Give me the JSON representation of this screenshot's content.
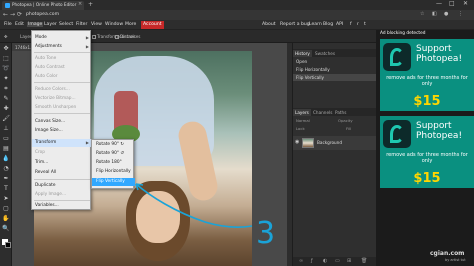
{
  "browser": {
    "tab_title": "Photopea | Online Photo Editor",
    "tab_close": "×",
    "new_tab": "+",
    "url": "photopea.com",
    "back": "←",
    "forward": "→",
    "reload": "⟳",
    "win_min": "—",
    "win_max": "□",
    "win_close": "✕"
  },
  "menubar": {
    "items": [
      "File",
      "Edit",
      "Image",
      "Layer",
      "Select",
      "Filter",
      "View",
      "Window",
      "More",
      "Account"
    ],
    "right": [
      "About",
      "Report a bug",
      "Learn",
      "Blog",
      "API"
    ],
    "social": [
      "f",
      "r",
      "t"
    ]
  },
  "options": {
    "autoselect": "Layer",
    "transform_controls": "Transform controls",
    "distances": "Distances"
  },
  "document": {
    "tab": "1746x1..."
  },
  "image_menu": {
    "items": [
      {
        "label": "Mode",
        "enabled": true,
        "submenu": true
      },
      {
        "label": "Adjustments",
        "enabled": true,
        "submenu": true
      },
      {
        "label": "Auto Tone",
        "enabled": false
      },
      {
        "label": "Auto Contrast",
        "enabled": false
      },
      {
        "label": "Auto Color",
        "enabled": false
      },
      {
        "label": "Reduce Colors...",
        "enabled": false
      },
      {
        "label": "Vectorize Bitmap...",
        "enabled": false
      },
      {
        "label": "Smooth Unsharpen",
        "enabled": false
      },
      {
        "label": "Canvas Size...",
        "enabled": true
      },
      {
        "label": "Image Size...",
        "enabled": true
      },
      {
        "label": "Transform",
        "enabled": true,
        "submenu": true
      },
      {
        "label": "Crop",
        "enabled": false
      },
      {
        "label": "Trim...",
        "enabled": true
      },
      {
        "label": "Reveal All",
        "enabled": true
      },
      {
        "label": "Duplicate",
        "enabled": true
      },
      {
        "label": "Apply Image...",
        "enabled": false
      },
      {
        "label": "Variables...",
        "enabled": true
      }
    ]
  },
  "transform_submenu": {
    "items": [
      {
        "label": "Rotate 90° ↻",
        "kbd": ""
      },
      {
        "label": "Rotate 90° ↺",
        "kbd": ""
      },
      {
        "label": "Rotate 180°",
        "kbd": ""
      },
      {
        "label": "Flip Horizontally",
        "kbd": ""
      },
      {
        "label": "Flip Vertically",
        "kbd": ""
      }
    ],
    "highlighted": "Flip Vertically"
  },
  "annotation": {
    "number": "3",
    "color": "#1aa3d8"
  },
  "history_panel": {
    "tabs": [
      "History",
      "Swatches"
    ],
    "rows": [
      "Open",
      "Flip Horizontally",
      "Flip Vertically"
    ]
  },
  "layers_panel": {
    "tabs": [
      "Layers",
      "Channels",
      "Paths"
    ],
    "blend_mode": "Normal",
    "opacity": "Opacity",
    "lock": "Lock",
    "fill": "Fill",
    "layer_name": "Background"
  },
  "ads": {
    "notice": "Ad blocking detected",
    "title": "Support Photopea!",
    "text": "remove ads for three months for only",
    "price": "$15"
  },
  "watermark": {
    "brand": "cgian.com",
    "sub": "by artist tut"
  }
}
